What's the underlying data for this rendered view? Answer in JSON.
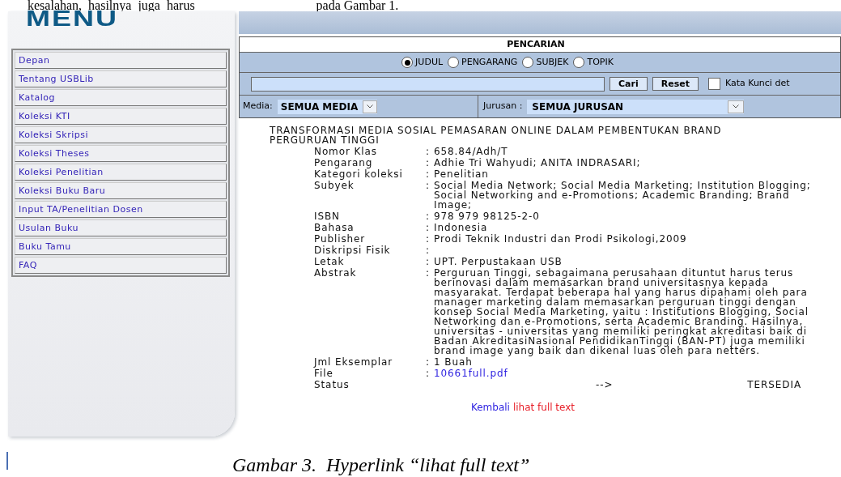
{
  "document_text": {
    "before": "kesalahan,  hasilnya  juga  harus",
    "after": "pada Gambar 1."
  },
  "sidebar": {
    "logo": "MENU",
    "items": [
      {
        "label": "Depan"
      },
      {
        "label": "Tentang USBLib"
      },
      {
        "label": "Katalog"
      },
      {
        "label": "Koleksi KTI"
      },
      {
        "label": "Koleksi Skripsi"
      },
      {
        "label": "Koleksi Theses"
      },
      {
        "label": "Koleksi Penelitian"
      },
      {
        "label": "Koleksi Buku Baru"
      },
      {
        "label": "Input TA/Penelitian Dosen"
      },
      {
        "label": "Usulan Buku"
      },
      {
        "label": "Buku Tamu"
      },
      {
        "label": "FAQ"
      }
    ]
  },
  "search": {
    "title": "PENCARIAN",
    "options": [
      {
        "label": "JUDUL",
        "selected": true
      },
      {
        "label": "PENGARANG",
        "selected": false
      },
      {
        "label": "SUBJEK",
        "selected": false
      },
      {
        "label": "TOPIK",
        "selected": false
      }
    ],
    "buttons": [
      "Cari",
      "Reset"
    ],
    "keyword_checkbox": {
      "label": "Kata Kunci det",
      "checked": false
    },
    "media": {
      "label": "Media:",
      "value": "SEMUA MEDIA"
    },
    "jurusan": {
      "label": "Jurusan :",
      "value": "SEMUA JURUSAN"
    }
  },
  "record": {
    "title": "TRANSFORMASI MEDIA SOSIAL PEMASARAN ONLINE DALAM PEMBENTUKAN BRAND PERGURUAN TINGGI",
    "separator": ":",
    "fields": [
      {
        "kind": "text",
        "label": "Nomor Klas",
        "value": "658.84/Adh/T"
      },
      {
        "kind": "text",
        "label": "Pengarang",
        "value": "Adhie Tri Wahyudi; ANITA INDRASARI;"
      },
      {
        "kind": "text",
        "label": "Kategori koleksi",
        "value": "Penelitian"
      },
      {
        "kind": "text",
        "label": "Subyek",
        "value": "Social Media Network; Social Media Marketing; Institution Blogging; Social Networking and e-Promotions; Academic Branding; Brand Image;"
      },
      {
        "kind": "text",
        "label": "ISBN",
        "value": "978 979 98125-2-0"
      },
      {
        "kind": "text",
        "label": "Bahasa",
        "value": "Indonesia"
      },
      {
        "kind": "text",
        "label": "Publisher",
        "value": "Prodi Teknik Industri dan Prodi Psikologi,2009"
      },
      {
        "kind": "text",
        "label": "Diskripsi Fisik"
      },
      {
        "kind": "text",
        "label": "Letak",
        "value": "UPT. Perpustakaan USB"
      },
      {
        "kind": "text",
        "label": "Abstrak",
        "value": "Perguruan Tinggi, sebagaimana perusahaan dituntut harus terus berinovasi dalam memasarkan brand universitasnya kepada masyarakat. Terdapat beberapa hal yang harus dipahami oleh para manager marketing dalam memasarkan perguruan tinggi dengan konsep Social Media Marketing, yaitu : Institutions Blogging, Social Networking dan e-Promotions, serta Academic Branding. Hasilnya, universitas - universitas yang memiliki peringkat akreditasi baik di Badan AkreditasiNasional PendidikanTinggi (BAN-PT) juga memiliki brand image yang baik dan dikenal luas oleh para netters."
      },
      {
        "kind": "text",
        "label": "Jml Eksemplar",
        "value": "1 Buah"
      },
      {
        "kind": "link",
        "label": "File",
        "value": "10661full.pdf"
      },
      {
        "kind": "status",
        "label": "Status",
        "value": "-->",
        "availability": "TERSEDIA"
      }
    ],
    "links": [
      {
        "label": "Kembali",
        "color": "#2b1fe0"
      },
      {
        "label": "lihat full text",
        "color": "#e8202a"
      }
    ]
  },
  "caption": "Gambar 3.  Hyperlink “lihat full text”"
}
